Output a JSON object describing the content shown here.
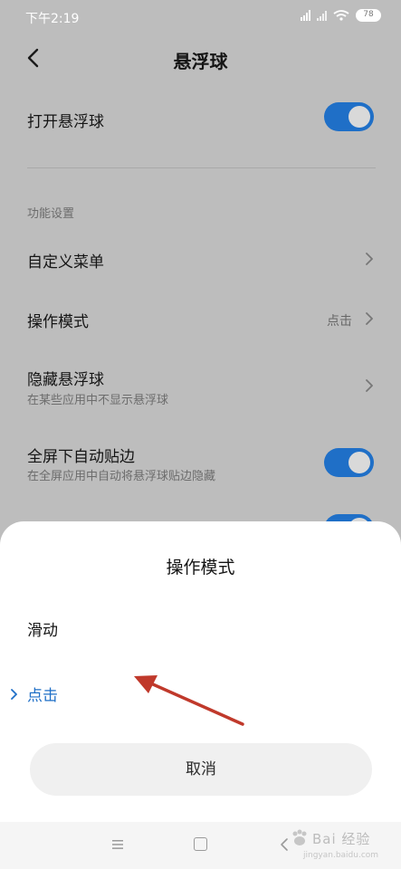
{
  "status_bar": {
    "time": "下午2:19",
    "battery": "78"
  },
  "header": {
    "title": "悬浮球"
  },
  "settings": {
    "floating_ball_label": "打开悬浮球",
    "floating_ball_on": true,
    "section_label": "功能设置",
    "custom_menu_label": "自定义菜单",
    "operation_mode_label": "操作模式",
    "operation_mode_value": "点击",
    "hide_ball_label": "隐藏悬浮球",
    "hide_ball_sub": "在某些应用中不显示悬浮球",
    "fullscreen_label": "全屏下自动贴边",
    "fullscreen_sub": "在全屏应用中自动将悬浮球贴边隐藏",
    "fullscreen_on": true
  },
  "sheet": {
    "title": "操作模式",
    "options": [
      {
        "label": "滑动",
        "selected": false
      },
      {
        "label": "点击",
        "selected": true
      }
    ],
    "cancel_label": "取消"
  },
  "watermark": {
    "text": "Bai 经验",
    "sub": "jingyan.baidu.com"
  },
  "colors": {
    "accent": "#1f6fc7",
    "annotation_arrow": "#c0392b"
  }
}
